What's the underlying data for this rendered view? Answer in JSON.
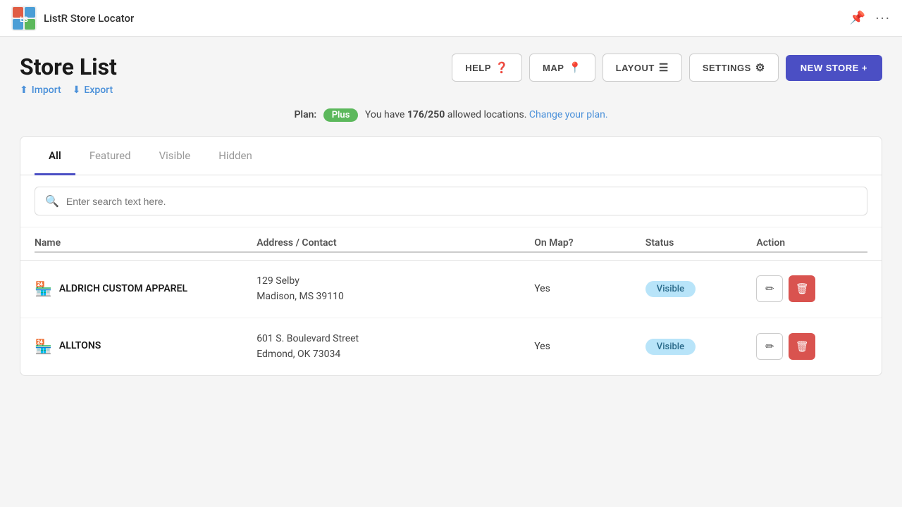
{
  "app": {
    "title": "ListR Store Locator"
  },
  "page": {
    "title": "Store List",
    "import_label": "Import",
    "export_label": "Export"
  },
  "toolbar": {
    "help_label": "HELP",
    "map_label": "MAP",
    "layout_label": "LAYOUT",
    "settings_label": "SETTINGS",
    "new_store_label": "NEW STORE +"
  },
  "plan": {
    "label": "Plan:",
    "badge": "Plus",
    "message_prefix": "You have",
    "count": "176/250",
    "message_suffix": "allowed locations.",
    "change_link": "Change your plan."
  },
  "tabs": [
    {
      "label": "All",
      "active": true
    },
    {
      "label": "Featured",
      "active": false
    },
    {
      "label": "Visible",
      "active": false
    },
    {
      "label": "Hidden",
      "active": false
    }
  ],
  "search": {
    "placeholder": "Enter search text here."
  },
  "table": {
    "columns": {
      "name": "Name",
      "address": "Address / Contact",
      "on_map": "On Map?",
      "status": "Status",
      "action": "Action"
    },
    "rows": [
      {
        "id": 1,
        "name": "ALDRICH CUSTOM APPAREL",
        "address_line1": "129 Selby",
        "address_line2": "Madison, MS 39110",
        "on_map": "Yes",
        "status": "Visible"
      },
      {
        "id": 2,
        "name": "ALLTONS",
        "address_line1": "601 S. Boulevard Street",
        "address_line2": "Edmond, OK 73034",
        "on_map": "Yes",
        "status": "Visible"
      }
    ]
  },
  "icons": {
    "pin": "📍",
    "gear": "⚙",
    "layout": "☰",
    "help": "❓",
    "store": "🏪",
    "pencil": "✏",
    "trash": "🗑",
    "search": "🔍",
    "import": "⬆",
    "export": "⬇",
    "pin_nav": "📌",
    "ellipsis": "···"
  },
  "colors": {
    "primary": "#4b4fc4",
    "danger": "#d9534f",
    "plan_badge": "#5cb85c",
    "status_bg": "#b8e4f9",
    "status_text": "#2a6a8a"
  }
}
